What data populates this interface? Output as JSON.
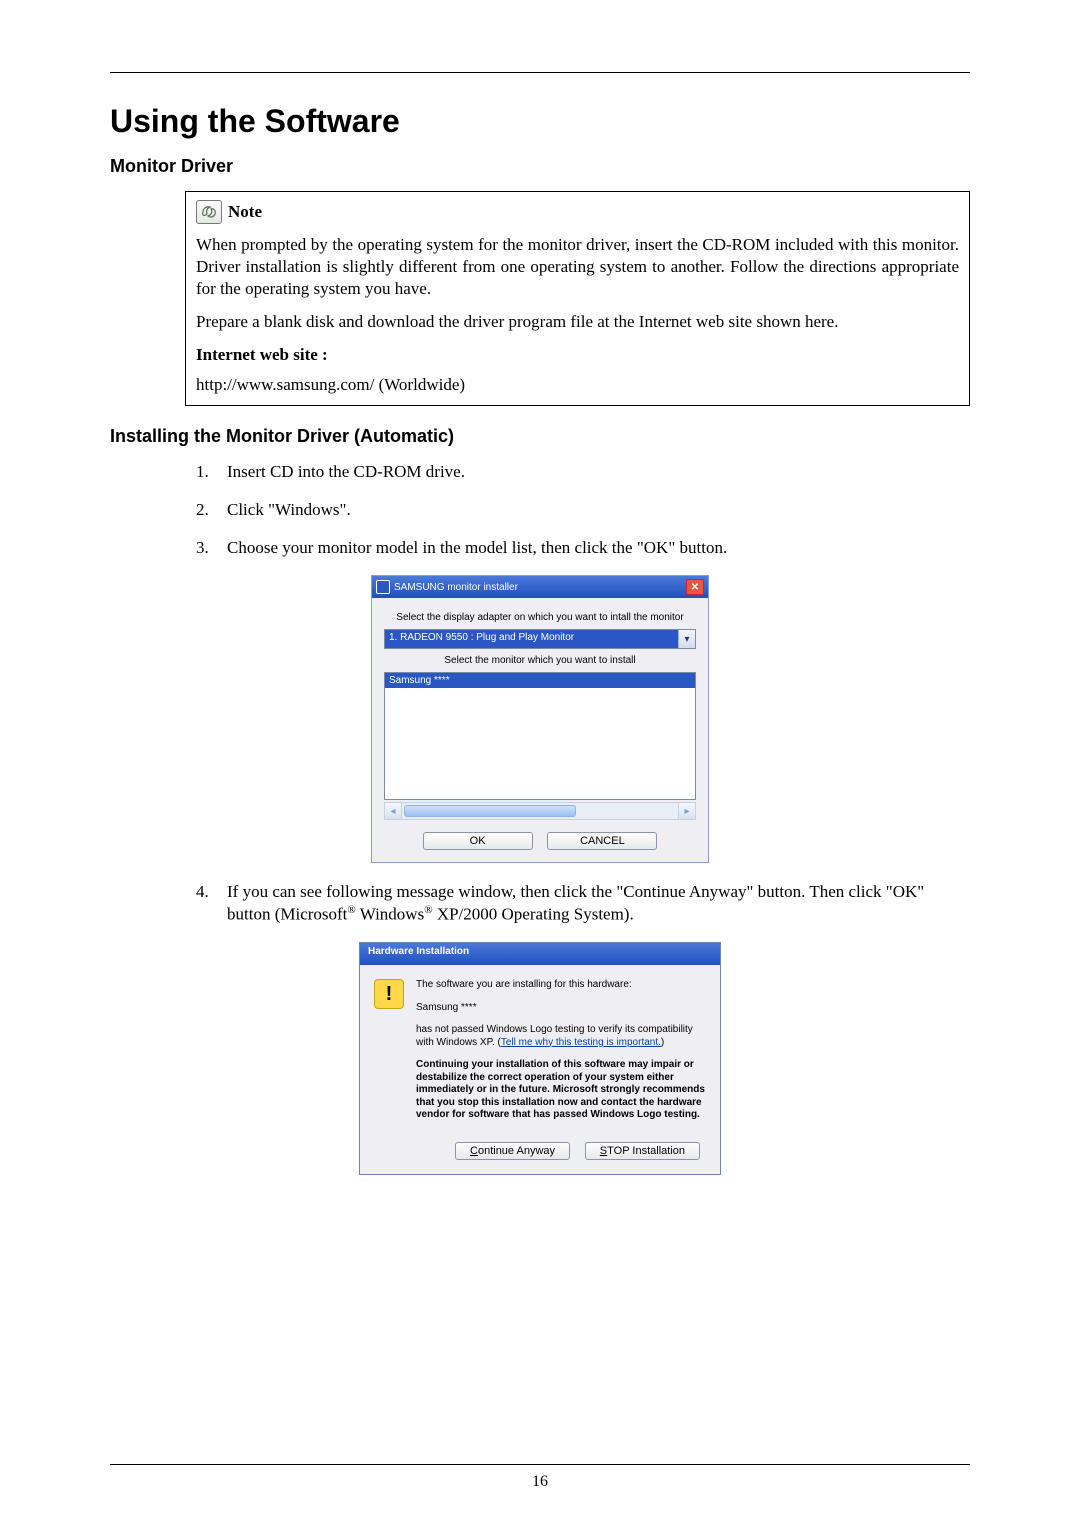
{
  "heading": "Using the Software",
  "section1": "Monitor Driver",
  "note": {
    "label": "Note",
    "p1": "When prompted by the operating system for the monitor driver, insert the CD-ROM included with this monitor. Driver installation is slightly different from one operating system to another. Follow the directions appropriate for the operating system you have.",
    "p2": "Prepare a blank disk and download the driver program file at the Internet web site shown here.",
    "iws_label": "Internet web site :",
    "url": "http://www.samsung.com/ (Worldwide)"
  },
  "section2": "Installing the Monitor Driver (Automatic)",
  "steps": {
    "s1": "Insert CD into the CD-ROM drive.",
    "s2": "Click \"Windows\".",
    "s3": "Choose your monitor model in the model list, then click the \"OK\" button.",
    "s4a": "If you can see following message window, then click the \"Continue Anyway\" button. Then click \"OK\" button (Microsoft",
    "s4b": " Windows",
    "s4c": " XP/2000 Operating System).",
    "reg": "®"
  },
  "installer": {
    "title": "SAMSUNG monitor installer",
    "instr1": "Select the display adapter on which you want to intall the monitor",
    "adapter": "1. RADEON 9550 : Plug and Play Monitor",
    "instr2": "Select the monitor which you want to install",
    "item": "Samsung ****",
    "ok": "OK",
    "cancel": "CANCEL",
    "close": "✕"
  },
  "hw": {
    "title": "Hardware Installation",
    "l1": "The software you are installing for this hardware:",
    "prod": "Samsung ****",
    "l2a": "has not passed Windows Logo testing to verify its compatibility with Windows XP. (",
    "link": "Tell me why this testing is important.",
    "l2b": ")",
    "bold": "Continuing your installation of this software may impair or destabilize the correct operation of your system either immediately or in the future. Microsoft strongly recommends that you stop this installation now and contact the hardware vendor for software that has passed Windows Logo testing.",
    "btn_cont_pre": "C",
    "btn_cont_rest": "ontinue Anyway",
    "btn_stop_pre": "S",
    "btn_stop_rest": "TOP Installation",
    "warn": "!"
  },
  "page_number": "16"
}
